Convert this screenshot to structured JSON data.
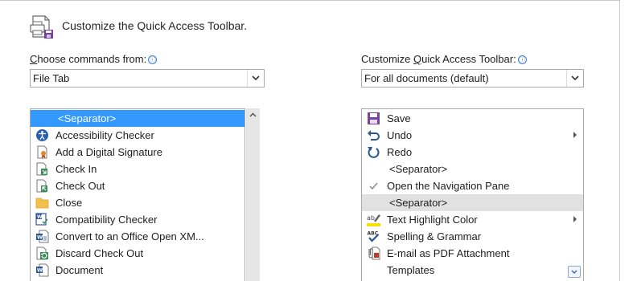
{
  "header": {
    "title": "Customize the Quick Access Toolbar."
  },
  "left": {
    "label_prefix": "",
    "label_mnemonic": "C",
    "label_rest": "hoose commands from:",
    "info_glyph": "ⓘ",
    "dropdown_value": "File Tab",
    "items": [
      {
        "label": "<Separator>",
        "icon": "none",
        "selected": true
      },
      {
        "label": "Accessibility Checker",
        "icon": "accessibility-checker-icon"
      },
      {
        "label": "Add a Digital Signature",
        "icon": "digital-signature-icon"
      },
      {
        "label": "Check In",
        "icon": "check-in-icon"
      },
      {
        "label": "Check Out",
        "icon": "check-out-icon"
      },
      {
        "label": "Close",
        "icon": "folder-icon"
      },
      {
        "label": "Compatibility Checker",
        "icon": "compatibility-checker-icon"
      },
      {
        "label": "Convert to an Office Open XM...",
        "icon": "convert-document-icon"
      },
      {
        "label": "Discard Check Out",
        "icon": "discard-check-out-icon"
      },
      {
        "label": "Document",
        "icon": "document-icon"
      }
    ]
  },
  "right": {
    "label_prefix": "Customize ",
    "label_mnemonic": "Q",
    "label_rest": "uick Access Toolbar:",
    "info_glyph": "ⓘ",
    "dropdown_value": "For all documents (default)",
    "items": [
      {
        "label": "Save",
        "icon": "save-icon"
      },
      {
        "label": "Undo",
        "icon": "undo-icon",
        "submenu": true
      },
      {
        "label": "Redo",
        "icon": "redo-icon"
      },
      {
        "label": "<Separator>",
        "icon": "none"
      },
      {
        "label": "Open the Navigation Pane",
        "icon": "checkmark-icon"
      },
      {
        "label": "<Separator>",
        "icon": "none",
        "highlighted": true
      },
      {
        "label": "Text Highlight Color",
        "icon": "highlight-color-icon",
        "submenu": true
      },
      {
        "label": "Spelling & Grammar",
        "icon": "spelling-grammar-icon"
      },
      {
        "label": "E-mail as PDF Attachment",
        "icon": "email-pdf-icon"
      },
      {
        "label": "Templates",
        "icon": "none"
      }
    ]
  },
  "colors": {
    "selection": "#3399ff",
    "highlight_row": "#e1e1e1",
    "accent_purple": "#7b3fa0"
  }
}
